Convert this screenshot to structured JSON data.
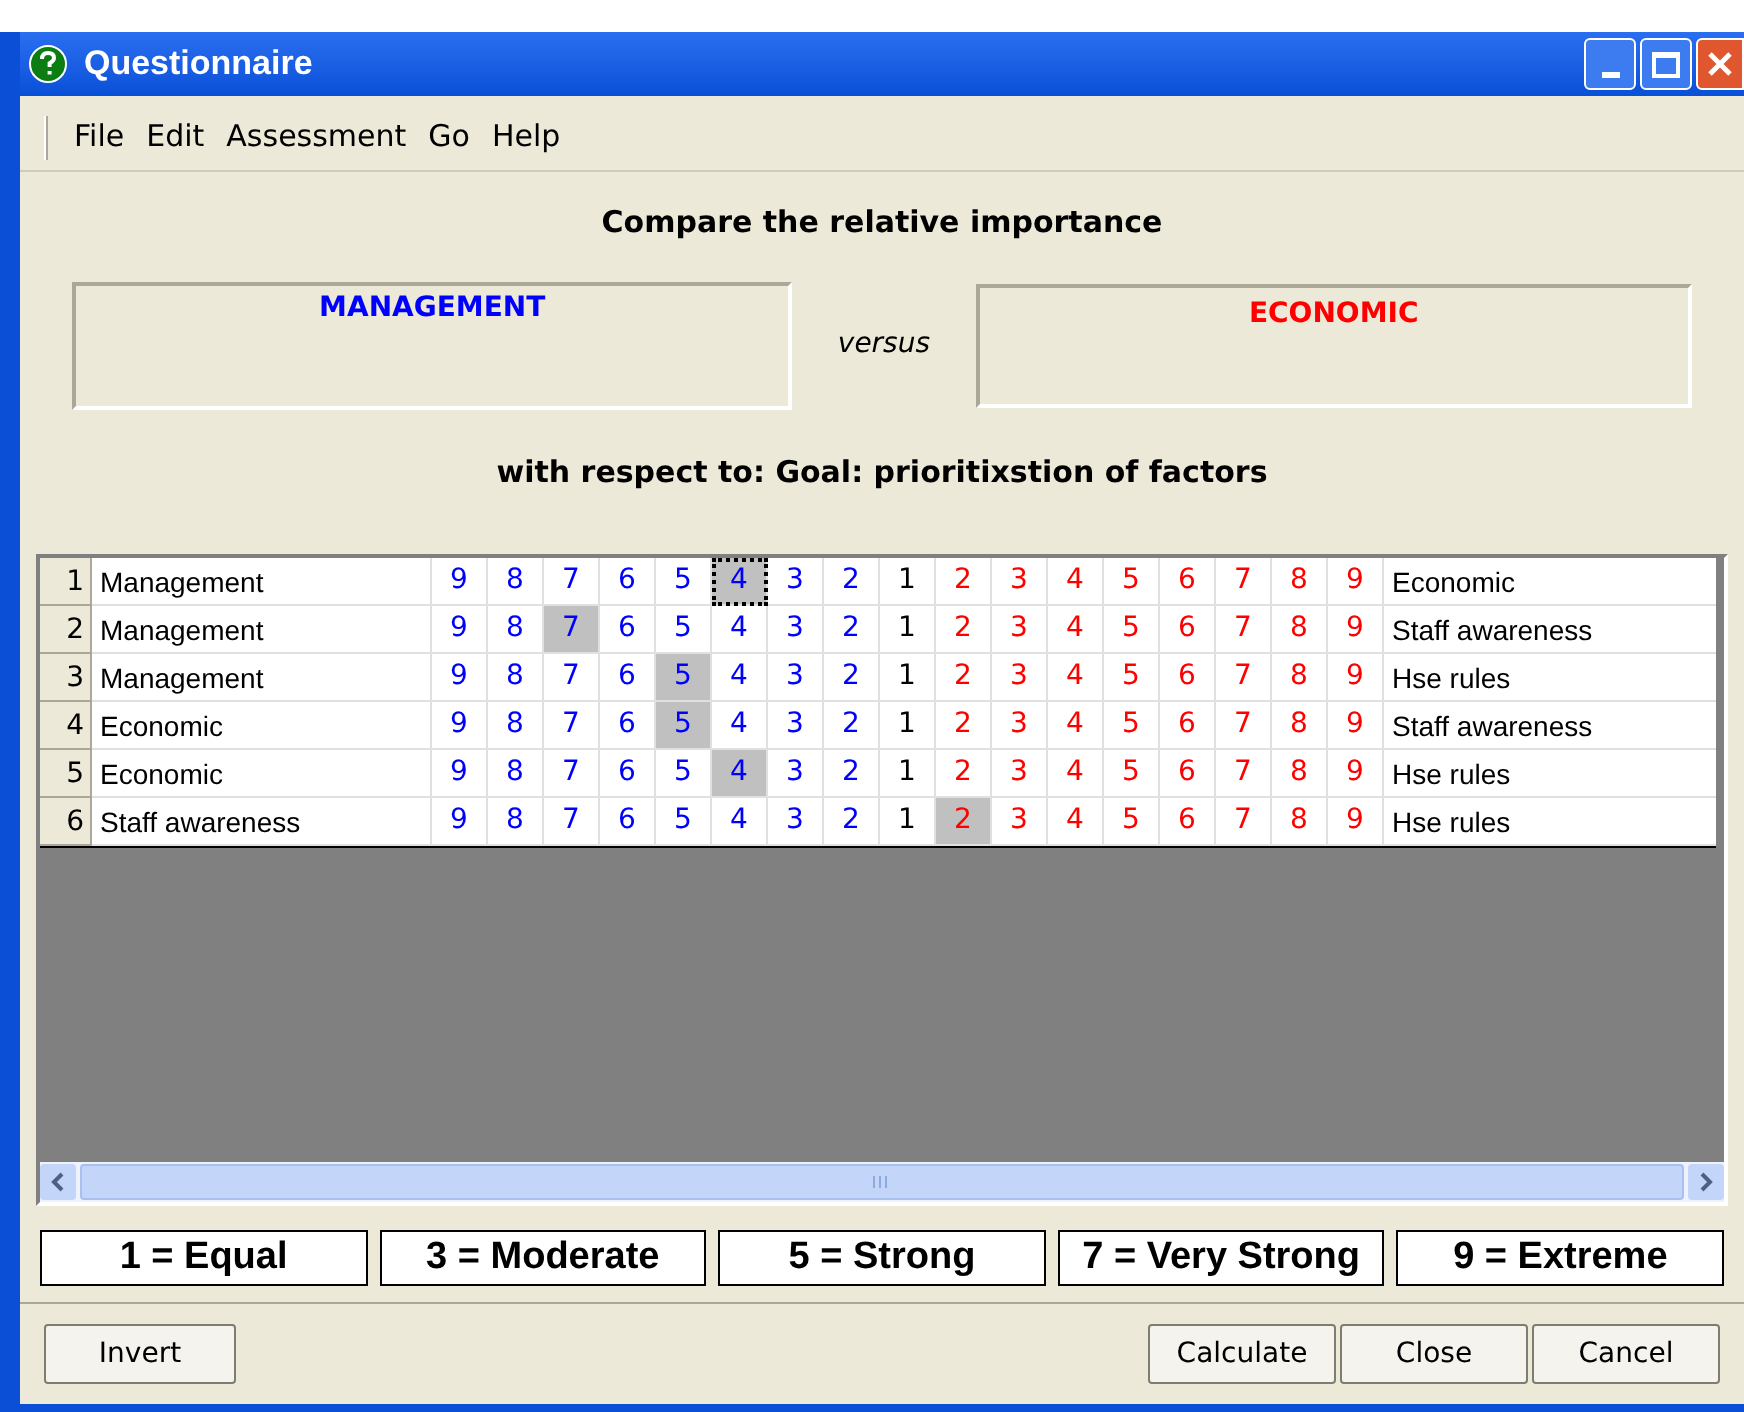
{
  "window": {
    "title": "Questionnaire"
  },
  "menu": [
    "File",
    "Edit",
    "Assessment",
    "Go",
    "Help"
  ],
  "heading": "Compare the relative importance",
  "left_factor": "MANAGEMENT",
  "versus": "versus",
  "right_factor": "ECONOMIC",
  "respect": "with respect to: Goal: prioritixstion of factors",
  "rows": [
    {
      "number": "1",
      "left": "Management",
      "right": "Economic",
      "focused": true,
      "cells": [
        {
          "text": "9",
          "kind": "left",
          "selected": false
        },
        {
          "text": "8",
          "kind": "left",
          "selected": false
        },
        {
          "text": "7",
          "kind": "left",
          "selected": false
        },
        {
          "text": "6",
          "kind": "left",
          "selected": false
        },
        {
          "text": "5",
          "kind": "left",
          "selected": false
        },
        {
          "text": "4",
          "kind": "left",
          "selected": true
        },
        {
          "text": "3",
          "kind": "left",
          "selected": false
        },
        {
          "text": "2",
          "kind": "left",
          "selected": false
        },
        {
          "text": "1",
          "kind": "neutral",
          "selected": false
        },
        {
          "text": "2",
          "kind": "right",
          "selected": false
        },
        {
          "text": "3",
          "kind": "right",
          "selected": false
        },
        {
          "text": "4",
          "kind": "right",
          "selected": false
        },
        {
          "text": "5",
          "kind": "right",
          "selected": false
        },
        {
          "text": "6",
          "kind": "right",
          "selected": false
        },
        {
          "text": "7",
          "kind": "right",
          "selected": false
        },
        {
          "text": "8",
          "kind": "right",
          "selected": false
        },
        {
          "text": "9",
          "kind": "right",
          "selected": false
        }
      ]
    },
    {
      "number": "2",
      "left": "Management",
      "right": "Staff awareness",
      "focused": false,
      "cells": [
        {
          "text": "9",
          "kind": "left",
          "selected": false
        },
        {
          "text": "8",
          "kind": "left",
          "selected": false
        },
        {
          "text": "7",
          "kind": "left",
          "selected": true
        },
        {
          "text": "6",
          "kind": "left",
          "selected": false
        },
        {
          "text": "5",
          "kind": "left",
          "selected": false
        },
        {
          "text": "4",
          "kind": "left",
          "selected": false
        },
        {
          "text": "3",
          "kind": "left",
          "selected": false
        },
        {
          "text": "2",
          "kind": "left",
          "selected": false
        },
        {
          "text": "1",
          "kind": "neutral",
          "selected": false
        },
        {
          "text": "2",
          "kind": "right",
          "selected": false
        },
        {
          "text": "3",
          "kind": "right",
          "selected": false
        },
        {
          "text": "4",
          "kind": "right",
          "selected": false
        },
        {
          "text": "5",
          "kind": "right",
          "selected": false
        },
        {
          "text": "6",
          "kind": "right",
          "selected": false
        },
        {
          "text": "7",
          "kind": "right",
          "selected": false
        },
        {
          "text": "8",
          "kind": "right",
          "selected": false
        },
        {
          "text": "9",
          "kind": "right",
          "selected": false
        }
      ]
    },
    {
      "number": "3",
      "left": "Management",
      "right": "Hse rules",
      "focused": false,
      "cells": [
        {
          "text": "9",
          "kind": "left",
          "selected": false
        },
        {
          "text": "8",
          "kind": "left",
          "selected": false
        },
        {
          "text": "7",
          "kind": "left",
          "selected": false
        },
        {
          "text": "6",
          "kind": "left",
          "selected": false
        },
        {
          "text": "5",
          "kind": "left",
          "selected": true
        },
        {
          "text": "4",
          "kind": "left",
          "selected": false
        },
        {
          "text": "3",
          "kind": "left",
          "selected": false
        },
        {
          "text": "2",
          "kind": "left",
          "selected": false
        },
        {
          "text": "1",
          "kind": "neutral",
          "selected": false
        },
        {
          "text": "2",
          "kind": "right",
          "selected": false
        },
        {
          "text": "3",
          "kind": "right",
          "selected": false
        },
        {
          "text": "4",
          "kind": "right",
          "selected": false
        },
        {
          "text": "5",
          "kind": "right",
          "selected": false
        },
        {
          "text": "6",
          "kind": "right",
          "selected": false
        },
        {
          "text": "7",
          "kind": "right",
          "selected": false
        },
        {
          "text": "8",
          "kind": "right",
          "selected": false
        },
        {
          "text": "9",
          "kind": "right",
          "selected": false
        }
      ]
    },
    {
      "number": "4",
      "left": "Economic",
      "right": "Staff awareness",
      "focused": false,
      "cells": [
        {
          "text": "9",
          "kind": "left",
          "selected": false
        },
        {
          "text": "8",
          "kind": "left",
          "selected": false
        },
        {
          "text": "7",
          "kind": "left",
          "selected": false
        },
        {
          "text": "6",
          "kind": "left",
          "selected": false
        },
        {
          "text": "5",
          "kind": "left",
          "selected": true
        },
        {
          "text": "4",
          "kind": "left",
          "selected": false
        },
        {
          "text": "3",
          "kind": "left",
          "selected": false
        },
        {
          "text": "2",
          "kind": "left",
          "selected": false
        },
        {
          "text": "1",
          "kind": "neutral",
          "selected": false
        },
        {
          "text": "2",
          "kind": "right",
          "selected": false
        },
        {
          "text": "3",
          "kind": "right",
          "selected": false
        },
        {
          "text": "4",
          "kind": "right",
          "selected": false
        },
        {
          "text": "5",
          "kind": "right",
          "selected": false
        },
        {
          "text": "6",
          "kind": "right",
          "selected": false
        },
        {
          "text": "7",
          "kind": "right",
          "selected": false
        },
        {
          "text": "8",
          "kind": "right",
          "selected": false
        },
        {
          "text": "9",
          "kind": "right",
          "selected": false
        }
      ]
    },
    {
      "number": "5",
      "left": "Economic",
      "right": "Hse rules",
      "focused": false,
      "cells": [
        {
          "text": "9",
          "kind": "left",
          "selected": false
        },
        {
          "text": "8",
          "kind": "left",
          "selected": false
        },
        {
          "text": "7",
          "kind": "left",
          "selected": false
        },
        {
          "text": "6",
          "kind": "left",
          "selected": false
        },
        {
          "text": "5",
          "kind": "left",
          "selected": false
        },
        {
          "text": "4",
          "kind": "left",
          "selected": true
        },
        {
          "text": "3",
          "kind": "left",
          "selected": false
        },
        {
          "text": "2",
          "kind": "left",
          "selected": false
        },
        {
          "text": "1",
          "kind": "neutral",
          "selected": false
        },
        {
          "text": "2",
          "kind": "right",
          "selected": false
        },
        {
          "text": "3",
          "kind": "right",
          "selected": false
        },
        {
          "text": "4",
          "kind": "right",
          "selected": false
        },
        {
          "text": "5",
          "kind": "right",
          "selected": false
        },
        {
          "text": "6",
          "kind": "right",
          "selected": false
        },
        {
          "text": "7",
          "kind": "right",
          "selected": false
        },
        {
          "text": "8",
          "kind": "right",
          "selected": false
        },
        {
          "text": "9",
          "kind": "right",
          "selected": false
        }
      ]
    },
    {
      "number": "6",
      "left": "Staff awareness",
      "right": "Hse rules",
      "focused": false,
      "cells": [
        {
          "text": "9",
          "kind": "left",
          "selected": false
        },
        {
          "text": "8",
          "kind": "left",
          "selected": false
        },
        {
          "text": "7",
          "kind": "left",
          "selected": false
        },
        {
          "text": "6",
          "kind": "left",
          "selected": false
        },
        {
          "text": "5",
          "kind": "left",
          "selected": false
        },
        {
          "text": "4",
          "kind": "left",
          "selected": false
        },
        {
          "text": "3",
          "kind": "left",
          "selected": false
        },
        {
          "text": "2",
          "kind": "left",
          "selected": false
        },
        {
          "text": "1",
          "kind": "neutral",
          "selected": false
        },
        {
          "text": "2",
          "kind": "right",
          "selected": true
        },
        {
          "text": "3",
          "kind": "right",
          "selected": false
        },
        {
          "text": "4",
          "kind": "right",
          "selected": false
        },
        {
          "text": "5",
          "kind": "right",
          "selected": false
        },
        {
          "text": "6",
          "kind": "right",
          "selected": false
        },
        {
          "text": "7",
          "kind": "right",
          "selected": false
        },
        {
          "text": "8",
          "kind": "right",
          "selected": false
        },
        {
          "text": "9",
          "kind": "right",
          "selected": false
        }
      ]
    }
  ],
  "legend": [
    "1 = Equal",
    "3 = Moderate",
    "5 = Strong",
    "7 = Very Strong",
    "9 = Extreme"
  ],
  "buttons_left": [
    "Invert"
  ],
  "buttons_right": [
    "Calculate",
    "Close",
    "Cancel"
  ]
}
